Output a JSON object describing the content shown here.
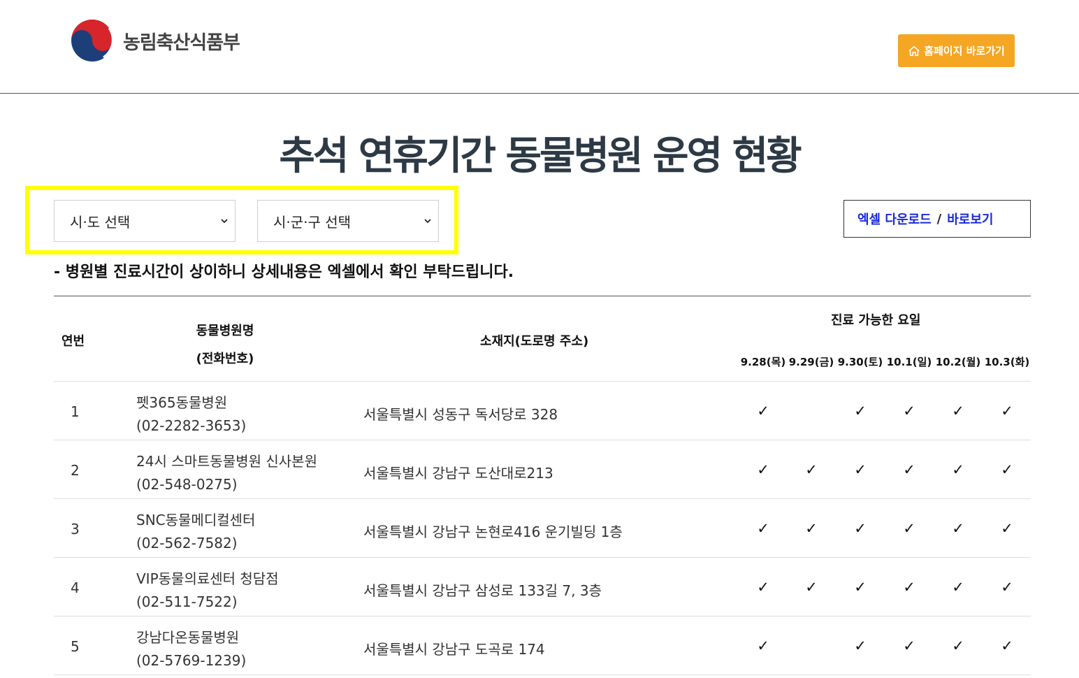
{
  "header": {
    "logo_text": "농림축산식품부",
    "home_button": "홈페이지 바로가기"
  },
  "title": "추석 연휴기간 동물병원 운영 현황",
  "filters": {
    "sido": "시·도 선택",
    "sigungu": "시·군·구 선택"
  },
  "excel": {
    "download": "엑셀 다운로드",
    "separator": "/",
    "view": "바로보기"
  },
  "notice": "- 병원별 진료시간이 상이하니 상세내용은 엑셀에서 확인 부탁드립니다.",
  "table": {
    "headers": {
      "no": "연번",
      "name_line1": "동물병원명",
      "name_line2": "(전화번호)",
      "address": "소재지(도로명 주소)",
      "days_title": "진료 가능한 요일"
    },
    "days": [
      "9.28(목)",
      "9.29(금)",
      "9.30(토)",
      "10.1(일)",
      "10.2(월)",
      "10.3(화)"
    ],
    "check_mark": "✓",
    "rows": [
      {
        "no": "1",
        "name": "펫365동물병원",
        "phone": "(02-2282-3653)",
        "address": "서울특별시 성동구 독서당로 328",
        "open": [
          true,
          false,
          true,
          true,
          true,
          true
        ]
      },
      {
        "no": "2",
        "name": "24시 스마트동물병원 신사본원",
        "phone": "(02-548-0275)",
        "address": "서울특별시 강남구 도산대로213",
        "open": [
          true,
          true,
          true,
          true,
          true,
          true
        ]
      },
      {
        "no": "3",
        "name": "SNC동물메디컬센터",
        "phone": "(02-562-7582)",
        "address": "서울특별시 강남구 논현로416 운기빌딩 1층",
        "open": [
          true,
          true,
          true,
          true,
          true,
          true
        ]
      },
      {
        "no": "4",
        "name": "VIP동물의료센터 청담점",
        "phone": "(02-511-7522)",
        "address": "서울특별시 강남구 삼성로 133길 7, 3층",
        "open": [
          true,
          true,
          true,
          true,
          true,
          true
        ]
      },
      {
        "no": "5",
        "name": "강남다온동물병원",
        "phone": "(02-5769-1239)",
        "address": "서울특별시 강남구 도곡로 174",
        "open": [
          true,
          false,
          true,
          true,
          true,
          true
        ]
      }
    ]
  },
  "colors": {
    "accent_orange": "#f5a623",
    "highlight_yellow": "#ffff00",
    "link_blue": "#1a2ad6",
    "title_color": "#2d3a45"
  }
}
